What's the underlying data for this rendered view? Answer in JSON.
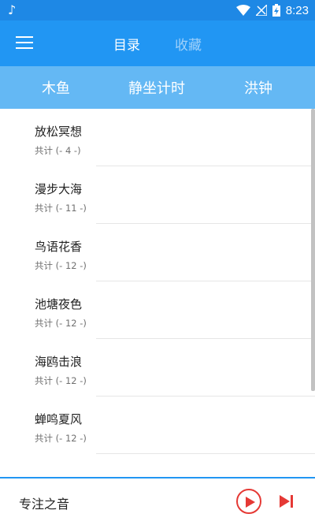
{
  "status_bar": {
    "time": "8:23",
    "icons": [
      "music-note-icon",
      "wifi-icon",
      "no-signal-icon",
      "battery-charging-icon"
    ]
  },
  "toolbar": {
    "menu_icon": "hamburger-menu-icon",
    "tabs": [
      {
        "label": "目录",
        "active": true
      },
      {
        "label": "收藏",
        "active": false
      }
    ]
  },
  "segments": [
    {
      "label": "木鱼"
    },
    {
      "label": "静坐计时"
    },
    {
      "label": "洪钟"
    }
  ],
  "list": [
    {
      "title": "放松冥想",
      "count": "共计 (- 4 -)"
    },
    {
      "title": "漫步大海",
      "count": "共计 (- 11 -)"
    },
    {
      "title": "鸟语花香",
      "count": "共计 (- 12 -)"
    },
    {
      "title": "池塘夜色",
      "count": "共计 (- 12 -)"
    },
    {
      "title": "海鸥击浪",
      "count": "共计 (- 12 -)"
    },
    {
      "title": "蝉鸣夏风",
      "count": "共计 (- 12 -)"
    }
  ],
  "player": {
    "title": "专注之音",
    "play_icon": "play-icon",
    "next_icon": "skip-next-icon"
  },
  "colors": {
    "primary": "#2196f3",
    "status_bar": "#1e88e5",
    "segment_bar": "#64b8f4",
    "accent": "#e53935"
  }
}
